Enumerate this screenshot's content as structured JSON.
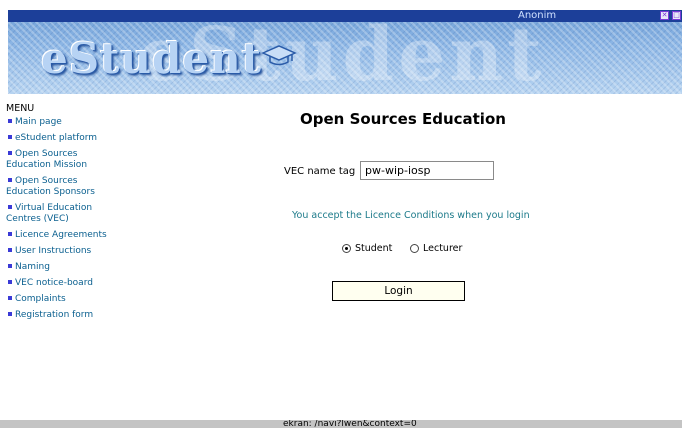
{
  "header": {
    "logo_text": "eStudent",
    "user_name": "Anonim",
    "close_glyph": "✕",
    "max_glyph": "□"
  },
  "sidebar": {
    "heading": "MENU",
    "items": [
      {
        "label": "Main page"
      },
      {
        "label": "eStudent platform"
      },
      {
        "label": "Open Sources Education Mission"
      },
      {
        "label": "Open Sources Education Sponsors"
      },
      {
        "label": "Virtual Education Centres (VEC)"
      },
      {
        "label": "Licence Agreements"
      },
      {
        "label": "User Instructions"
      },
      {
        "label": "Naming"
      },
      {
        "label": "VEC notice-board"
      },
      {
        "label": "Complaints"
      },
      {
        "label": "Registration form"
      }
    ]
  },
  "main": {
    "title": "Open Sources Education",
    "vec_label": "VEC name tag",
    "vec_value": "pw-wip-iosp",
    "licence_notice": "You accept the Licence Conditions when you login",
    "role_options": [
      {
        "label": "Student",
        "checked": true
      },
      {
        "label": "Lecturer",
        "checked": false
      }
    ],
    "login_label": "Login"
  },
  "status_bar": {
    "text": "ekran: /navi?lwen&context=0"
  },
  "colors": {
    "banner_top": "#1c3f99",
    "menu_link": "#0a5f8f",
    "notice": "#1c7a8a"
  }
}
